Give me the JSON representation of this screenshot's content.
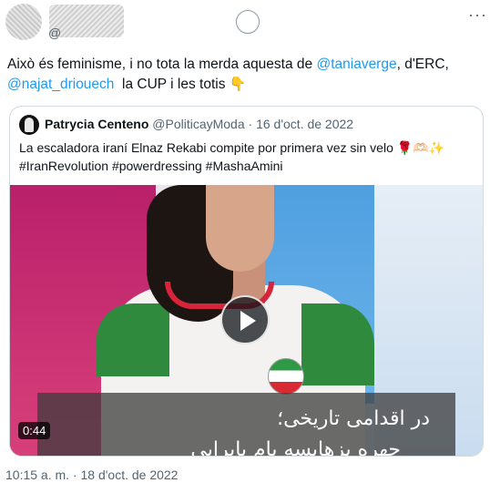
{
  "author": {
    "handle_prefix": "@"
  },
  "tweet": {
    "text_part1": "Això és feminisme, i no tota la merda aquesta de ",
    "mention1": "@taniaverge",
    "text_part2": ", d'ERC,",
    "mention2": "@najat_driouech",
    "text_part3": "  la CUP i les totis ",
    "emoji": "👇"
  },
  "quote": {
    "name": "Patrycia Centeno",
    "handle": "@PoliticayModa",
    "separator": " · ",
    "date": "16 d'oct. de 2022",
    "text_line1": "La escaladora iraní Elnaz Rekabi compite por primera vez sin velo ",
    "emojis": "🌹🫶🏻✨",
    "text_line2": "#IranRevolution #powerdressing #MashaAmini",
    "video": {
      "caption_line1": "در اقدامی تاریخی؛",
      "caption_line2": "جهره بزهایسه یام یایرایی",
      "duration": "0:44"
    }
  },
  "timestamp": "10:15 a. m. · 18 d'oct. de 2022",
  "icons": {
    "more": "more-dots-icon",
    "play": "play-icon",
    "grok": "circle-icon"
  }
}
